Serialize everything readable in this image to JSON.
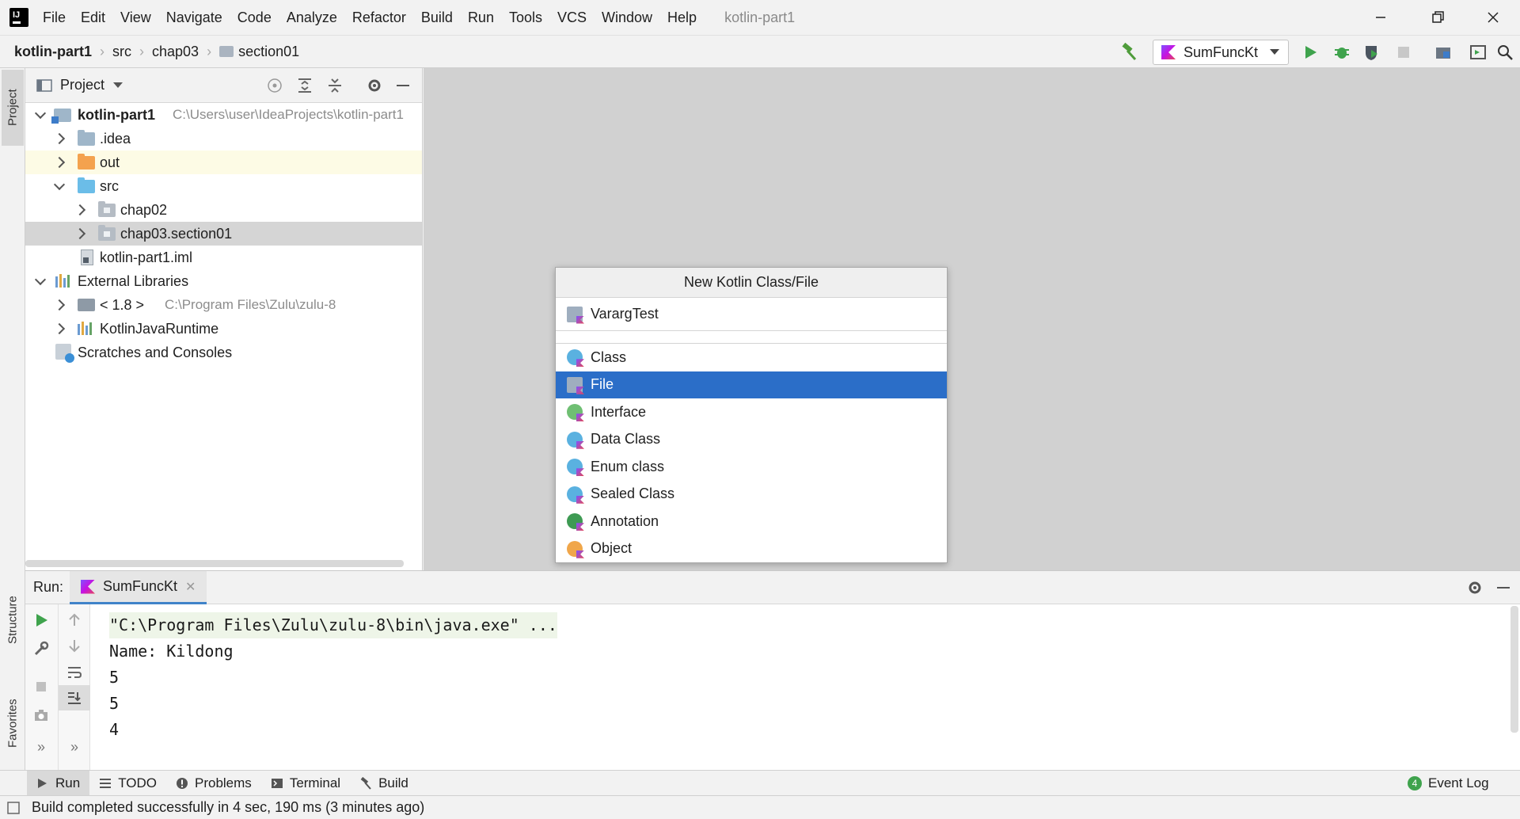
{
  "menu": {
    "items": [
      "File",
      "Edit",
      "View",
      "Navigate",
      "Code",
      "Analyze",
      "Refactor",
      "Build",
      "Run",
      "Tools",
      "VCS",
      "Window",
      "Help"
    ],
    "window_title": "kotlin-part1"
  },
  "breadcrumb": [
    "kotlin-part1",
    "src",
    "chap03",
    "section01"
  ],
  "run_config": {
    "label": "SumFuncKt"
  },
  "left_stripe": {
    "project": "Project",
    "structure": "Structure",
    "favorites": "Favorites"
  },
  "project_panel": {
    "title": "Project",
    "tree": [
      {
        "label": "kotlin-part1",
        "hint": "C:\\Users\\user\\IdeaProjects\\kotlin-part1"
      },
      {
        "label": ".idea"
      },
      {
        "label": "out"
      },
      {
        "label": "src"
      },
      {
        "label": "chap02"
      },
      {
        "label": "chap03.section01"
      },
      {
        "label": "kotlin-part1.iml"
      },
      {
        "label": "External Libraries"
      },
      {
        "label": "< 1.8 >",
        "hint": "C:\\Program Files\\Zulu\\zulu-8"
      },
      {
        "label": "KotlinJavaRuntime"
      },
      {
        "label": "Scratches and Consoles"
      }
    ]
  },
  "dialog": {
    "title": "New Kotlin Class/File",
    "input_value": "VarargTest",
    "items": [
      "Class",
      "File",
      "Interface",
      "Data Class",
      "Enum class",
      "Sealed Class",
      "Annotation",
      "Object"
    ],
    "selected": "File"
  },
  "run_panel": {
    "label": "Run:",
    "tab": "SumFuncKt",
    "console": [
      "\"C:\\Program Files\\Zulu\\zulu-8\\bin\\java.exe\" ...",
      "Name: Kildong",
      "5",
      "5",
      "4"
    ]
  },
  "bottom_tabs": [
    "Run",
    "TODO",
    "Problems",
    "Terminal",
    "Build"
  ],
  "event_log": {
    "badge": "4",
    "label": "Event Log"
  },
  "status": "Build completed successfully in 4 sec, 190 ms (3 minutes ago)"
}
